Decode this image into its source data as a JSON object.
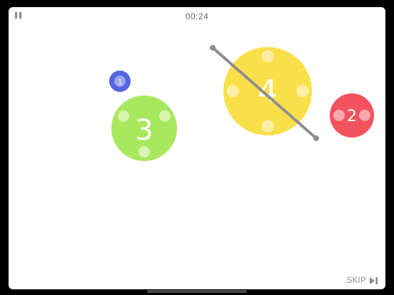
{
  "hud": {
    "timer": "00:24",
    "pause_icon": "pause-icon",
    "skip_label": "SKIP",
    "skip_icon": "skip-forward-icon"
  },
  "circles": [
    {
      "id": "circle-1",
      "number": "1",
      "color": "#5465e0",
      "dots": 0
    },
    {
      "id": "circle-3",
      "number": "3",
      "color": "#a8e85e",
      "dots": 3
    },
    {
      "id": "circle-4",
      "number": "4",
      "color": "#f9e04b",
      "dots": 4
    },
    {
      "id": "circle-2",
      "number": "2",
      "color": "#f2545f",
      "dots": 2
    }
  ],
  "slice_line": {
    "color": "#8f8f8f"
  }
}
